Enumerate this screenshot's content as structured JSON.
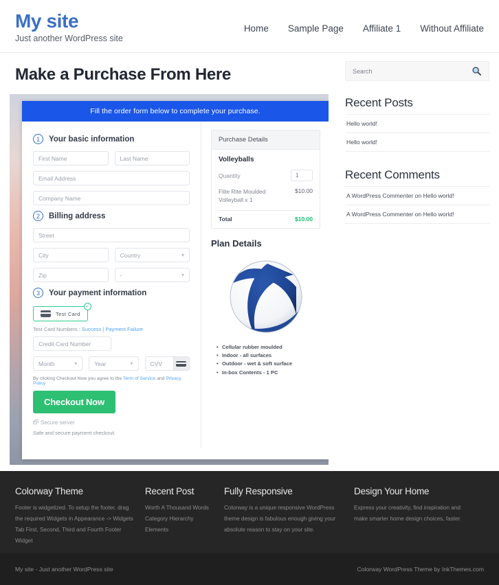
{
  "header": {
    "site_title": "My site",
    "tagline": "Just another WordPress site",
    "nav": [
      {
        "label": "Home"
      },
      {
        "label": "Sample Page"
      },
      {
        "label": "Affiliate 1"
      },
      {
        "label": "Without Affiliate"
      }
    ]
  },
  "main": {
    "page_title": "Make a Purchase From Here",
    "order_form": {
      "banner": "Fill the order form below to complete your purchase.",
      "steps": {
        "basic": {
          "num": "1",
          "label": "Your basic information"
        },
        "billing": {
          "num": "2",
          "label": "Billing address"
        },
        "payment": {
          "num": "3",
          "label": "Your payment information"
        }
      },
      "fields": {
        "first_name": "First Name",
        "last_name": "Last Name",
        "email": "Email Address",
        "company": "Company Name",
        "street": "Street",
        "city": "City",
        "country": "Country",
        "zip": "Zip",
        "state": "-",
        "credit_card": "Credit Card Number",
        "month": "Month",
        "year": "Year",
        "cvv": "CVV"
      },
      "payment_method": {
        "label": "Test Card",
        "check": "✓"
      },
      "test_numbers": {
        "prefix": "Test Card Numbers : ",
        "success": "Success",
        "divider": " | ",
        "failure": "Payment Failure"
      },
      "terms": {
        "prefix": "By clicking Checkout Now you agree to the ",
        "tos": "Term of Service",
        "middle": " and ",
        "privacy": "Privacy Policy"
      },
      "checkout_button": "Checkout Now",
      "secure_server": "Secure server",
      "safe_text": "Safe and secure payment checkout."
    },
    "purchase_details": {
      "heading": "Purchase Details",
      "product": "Volleyballs",
      "quantity_label": "Quantity",
      "quantity_value": "1",
      "item_name": "Flite Rite Moulded Volleyball x 1",
      "item_price": "$10.00",
      "total_label": "Total",
      "total_value": "$10.00"
    },
    "plan_details": {
      "heading": "Plan Details",
      "features": [
        "Cellular rubber moulded",
        "Indoor - all surfaces",
        "Outdoor - wet & soft surface",
        "In-box Contents - 1 PC"
      ]
    }
  },
  "sidebar": {
    "search": {
      "placeholder": "Search",
      "icon": "search-icon"
    },
    "recent_posts": {
      "title": "Recent Posts",
      "items": [
        "Hello world!",
        "Hello world!"
      ]
    },
    "recent_comments": {
      "title": "Recent Comments",
      "items": [
        "A WordPress Commenter on Hello world!",
        "A WordPress Commenter on Hello world!"
      ]
    }
  },
  "footer": {
    "columns": [
      {
        "title": "Colorway Theme",
        "text": "Footer is widgetized. To setup the footer, drag the required Widgets in Appearance -> Widgets Tab First, Second, Third and Fourth Footer Widget"
      },
      {
        "title": "Recent Post",
        "items": [
          "Worth A Thousand Words",
          "Category Hierarchy",
          "Elements"
        ]
      },
      {
        "title": "Fully Responsive",
        "text": "Colorway is a unique responsive WordPress theme design is fabulous enough giving your absolute reason to stay on your site."
      },
      {
        "title": "Design Your Home",
        "text": "Express your creativity, find inspiration and make smarter home design choices, faster."
      }
    ],
    "bottom_left": "My site - Just another WordPress site",
    "bottom_right": "Colorway WordPress Theme by InkThemes.com"
  },
  "colors": {
    "brand": "#3b6fc4",
    "banner": "#1a56e8",
    "accent_green": "#2dbf72",
    "total_green": "#16c172",
    "footer_bg": "#262626"
  }
}
